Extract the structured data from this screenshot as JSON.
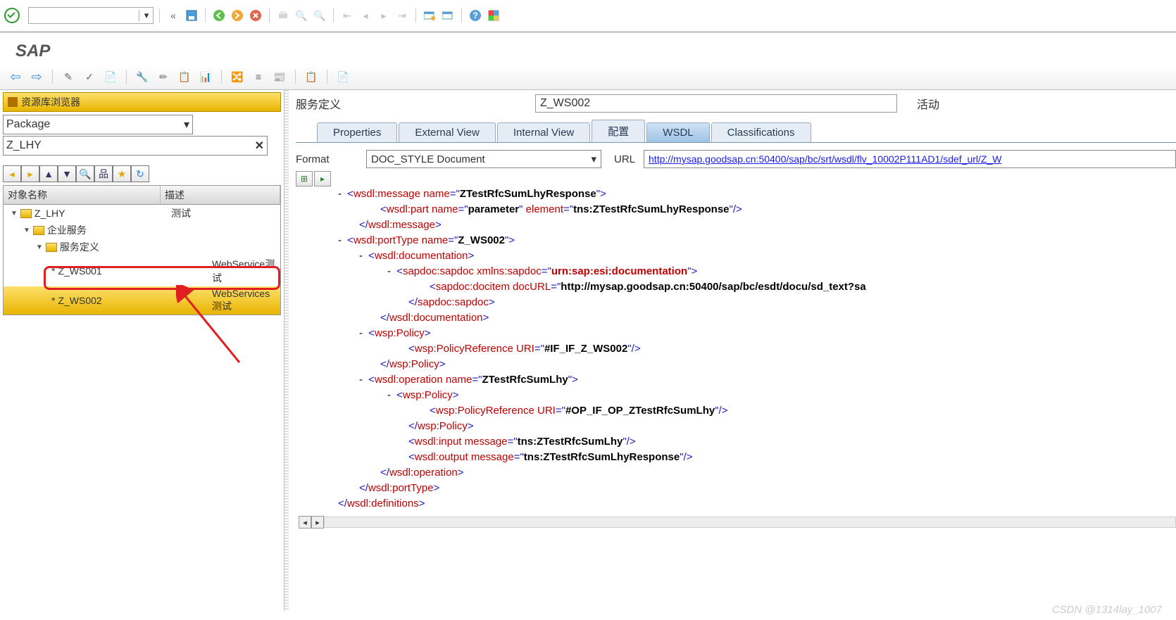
{
  "app_title": "SAP",
  "sys_toolbar": {
    "command_value": ""
  },
  "left": {
    "repo_title": "资源库浏览器",
    "package_select": "Package",
    "package_value": "Z_LHY",
    "columns": {
      "name": "对象名称",
      "desc": "描述"
    },
    "tree": [
      {
        "name": "Z_LHY",
        "desc": "测试",
        "icon": "folder-open"
      },
      {
        "name": "企业服务",
        "desc": "",
        "icon": "folder-open"
      },
      {
        "name": "服务定义",
        "desc": "",
        "icon": "folder-open"
      },
      {
        "name": "Z_WS001",
        "desc": "WebService测试",
        "icon": "item",
        "prefix": "*"
      },
      {
        "name": "Z_WS002",
        "desc": "WebServices测试",
        "icon": "item",
        "prefix": "*",
        "selected": true
      }
    ]
  },
  "right": {
    "service_label": "服务定义",
    "service_value": "Z_WS002",
    "status": "活动",
    "tabs": [
      "Properties",
      "External View",
      "Internal View",
      "配置",
      "WSDL",
      "Classifications"
    ],
    "active_tab": "WSDL",
    "format_label": "Format",
    "format_value": "DOC_STYLE Document",
    "url_label": "URL",
    "url_value": "http://mysap.goodsap.cn:50400/sap/bc/srt/wsdl/flv_10002P111AD1/sdef_url/Z_W",
    "xml": {
      "msg_open": "wsdl:message",
      "msg_name": "ZTestRfcSumLhyResponse",
      "part": "wsdl:part",
      "part_name": "parameter",
      "part_elem_attr": "element",
      "part_elem_val": "tns:ZTestRfcSumLhyResponse",
      "msg_close": "wsdl:message",
      "porttype": "wsdl:portType",
      "porttype_name": "Z_WS002",
      "doc": "wsdl:documentation",
      "sapdoc": "sapdoc:sapdoc",
      "sapdoc_ns": "xmlns:sapdoc",
      "sapdoc_ns_val": "urn:sap:esi:documentation",
      "docitem": "sapdoc:docitem",
      "docitem_attr": "docURL",
      "docitem_val": "http://mysap.goodsap.cn:50400/sap/bc/esdt/docu/sd_text?sa",
      "policy": "wsp:Policy",
      "policyref": "wsp:PolicyReference",
      "policyref_attr": "URI",
      "policyref_val1": "#IF_IF_Z_WS002",
      "operation": "wsdl:operation",
      "operation_name": "ZTestRfcSumLhy",
      "policyref_val2": "#OP_IF_OP_ZTestRfcSumLhy",
      "input": "wsdl:input",
      "input_attr": "message",
      "input_val": "tns:ZTestRfcSumLhy",
      "output": "wsdl:output",
      "output_val": "tns:ZTestRfcSumLhyResponse",
      "definitions": "wsdl:definitions"
    }
  },
  "watermark": "CSDN @1314lay_1007"
}
